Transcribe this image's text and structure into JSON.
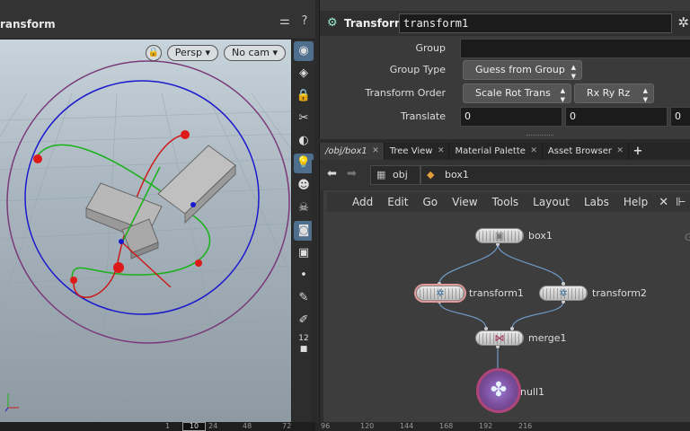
{
  "viewport": {
    "title": "ransform",
    "header_icons": [
      "view-options-icon",
      "help-icon"
    ],
    "camera_menu": "Persp",
    "cam_menu": "No cam",
    "toolbar_tools": [
      "display-options-icon",
      "wireframe-icon",
      "lock-icon",
      "snap-icon",
      "light-icon",
      "light-bulb-icon",
      "ghost-icon",
      "skull-icon",
      "camera-icon",
      "render-icon",
      "point-icon",
      "pencil-icon",
      "brush-icon",
      "frame-icon"
    ],
    "frame_overlay": "12"
  },
  "timeline": {
    "current_frame": "10",
    "ticks": [
      "1",
      "24",
      "48",
      "72",
      "96",
      "120",
      "144",
      "168",
      "192",
      "216"
    ]
  },
  "params": {
    "node_type": "Transform",
    "node_name": "transform1",
    "rows": [
      {
        "label": "Group",
        "value": ""
      },
      {
        "label": "Group Type",
        "value": "Guess from Group"
      },
      {
        "label": "Transform Order",
        "value": "Scale Rot Trans",
        "value2": "Rx Ry Rz"
      },
      {
        "label": "Translate",
        "x": "0",
        "y": "0",
        "z": "0"
      }
    ]
  },
  "tabs": [
    {
      "label": "/obj/box1",
      "active": true
    },
    {
      "label": "Tree View"
    },
    {
      "label": "Material Palette"
    },
    {
      "label": "Asset Browser"
    }
  ],
  "path": {
    "obj": "obj",
    "node": "box1"
  },
  "network_menu": [
    "Add",
    "Edit",
    "Go",
    "View",
    "Tools",
    "Layout",
    "Labs",
    "Help"
  ],
  "nodes": {
    "box1": "box1",
    "transform1": "transform1",
    "transform2": "transform2",
    "merge1": "merge1",
    "null1": "null1"
  },
  "colors": {
    "accent": "#4e6f8e",
    "selected_outline": "#e39a9a",
    "null_node": "#7a4c9a",
    "wire": "#6f9cc9"
  }
}
